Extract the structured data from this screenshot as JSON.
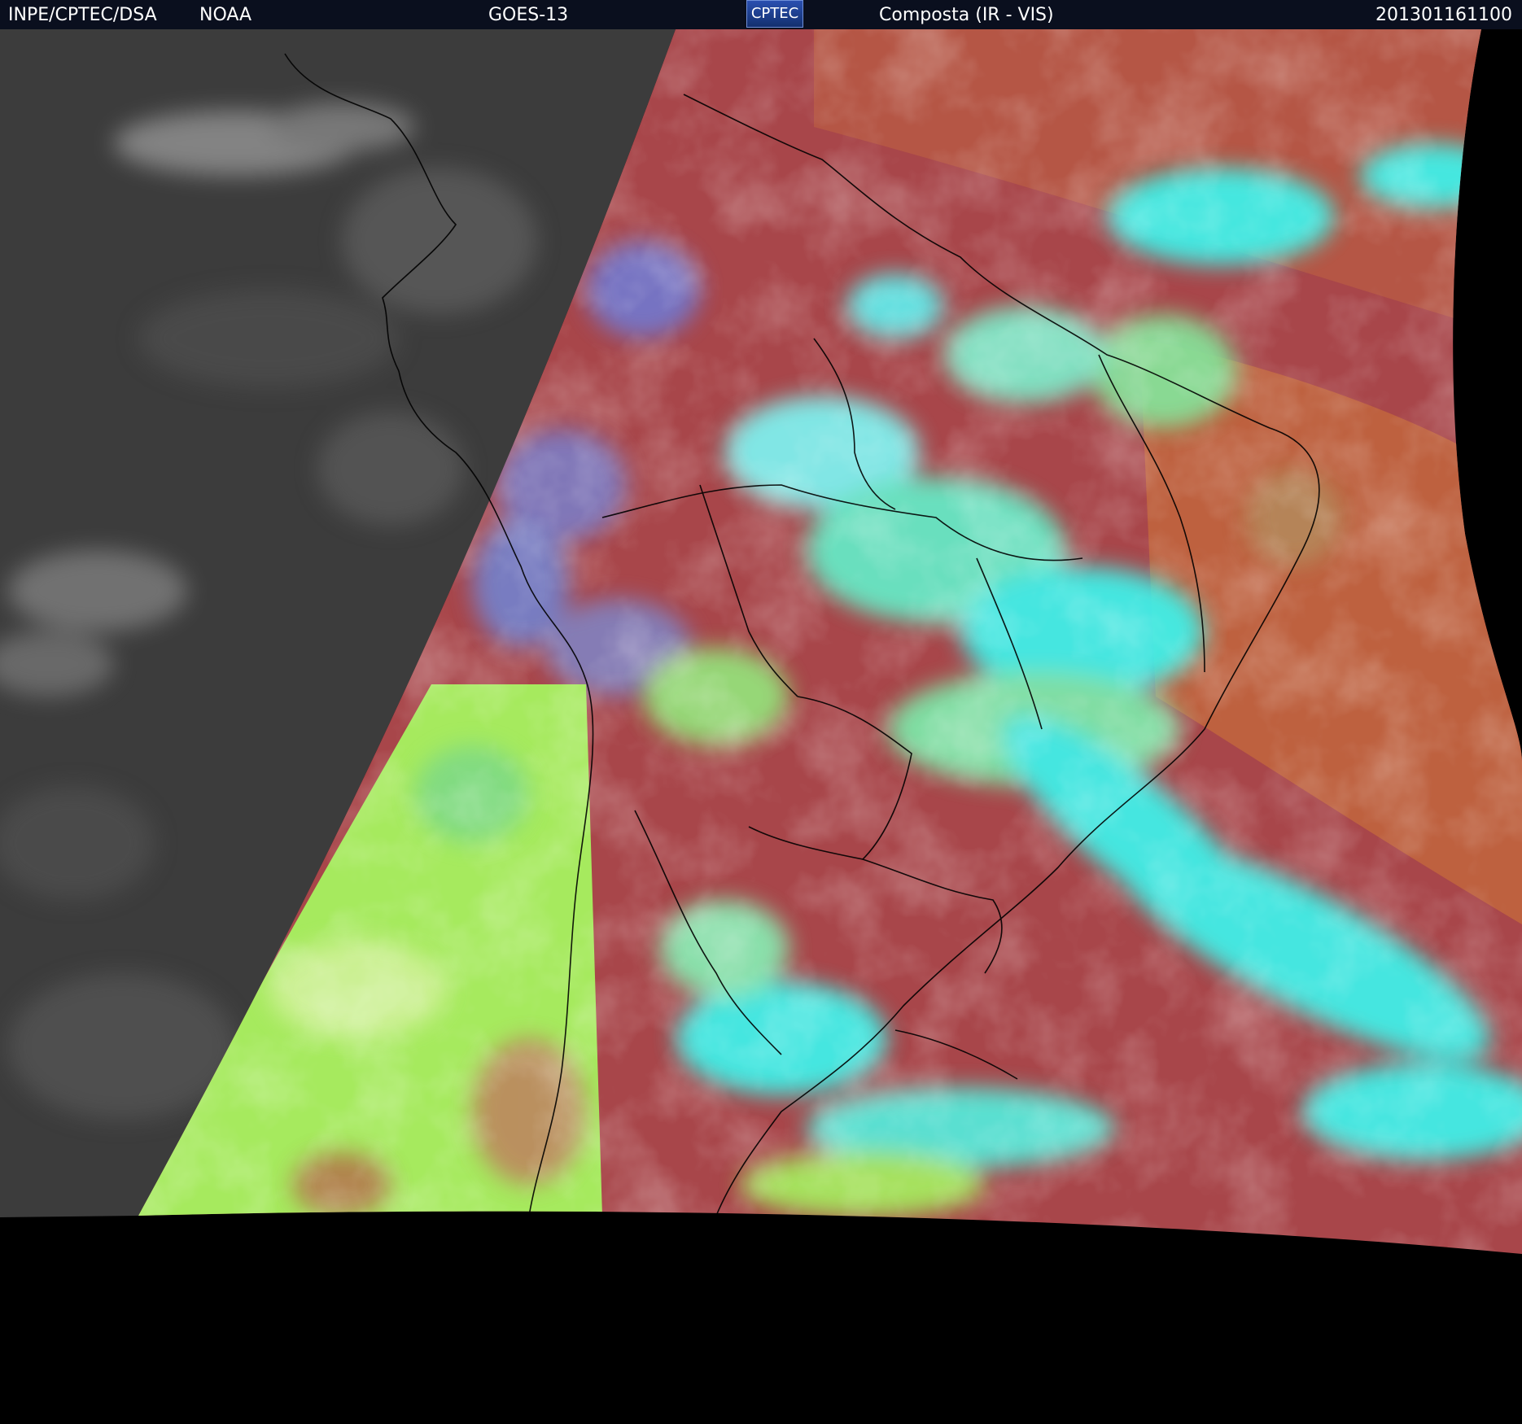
{
  "header": {
    "org": "INPE/CPTEC/DSA",
    "agency": "NOAA",
    "satellite": "GOES-13",
    "logo_text": "CPTEC",
    "product": "Composta (IR - VIS)",
    "timestamp": "201301161100"
  },
  "colors": {
    "header_bg": "#0a0f1e",
    "ir_gray": "#3c3c3c",
    "land_red": "#a8464a",
    "cloud_cyan": "#3ff0e8",
    "cloud_green": "#a6ea5e",
    "ocean_orange": "#c0643e",
    "border_black": "#000000"
  }
}
